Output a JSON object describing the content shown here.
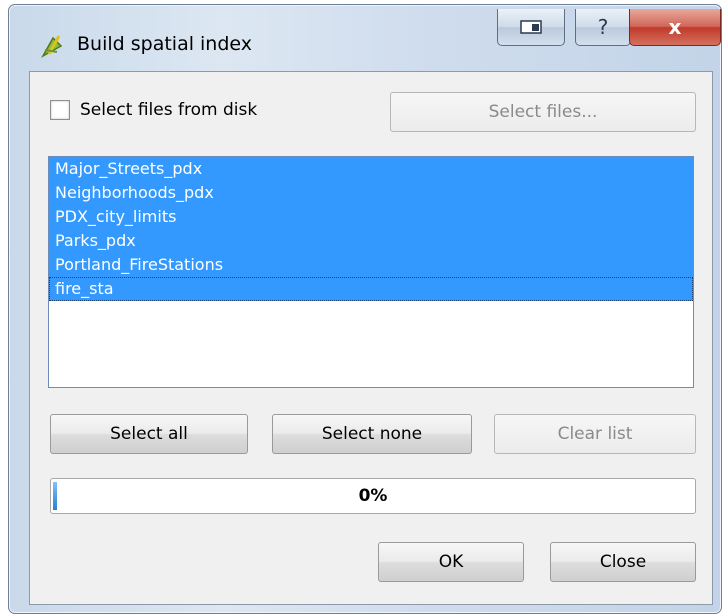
{
  "window": {
    "title": "Build spatial index",
    "help_glyph": "?",
    "close_glyph": "x"
  },
  "select_from_disk": {
    "label": "Select files from disk",
    "checked": false
  },
  "select_files_button": {
    "label": "Select files...",
    "enabled": false
  },
  "layers": [
    {
      "name": "Major_Streets_pdx",
      "selected": true
    },
    {
      "name": "Neighborhoods_pdx",
      "selected": true
    },
    {
      "name": "PDX_city_limits",
      "selected": true
    },
    {
      "name": "Parks_pdx",
      "selected": true
    },
    {
      "name": "Portland_FireStations",
      "selected": true
    },
    {
      "name": "fire_sta",
      "selected": true,
      "current": true
    }
  ],
  "buttons": {
    "select_all": "Select all",
    "select_none": "Select none",
    "clear_list": "Clear list",
    "ok": "OK",
    "close": "Close"
  },
  "progress": {
    "value": 0,
    "text": "0%"
  },
  "colors": {
    "selection": "#3399ff",
    "close_button": "#c23a2a"
  }
}
